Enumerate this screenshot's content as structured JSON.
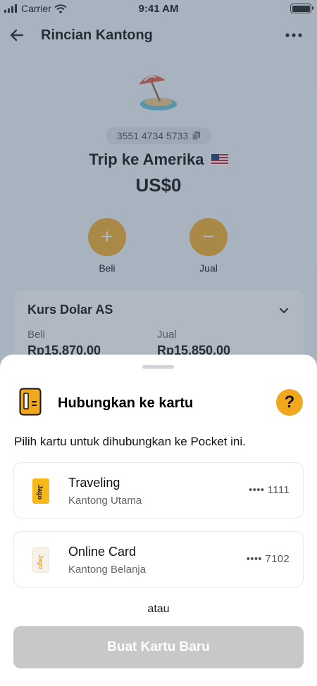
{
  "status_bar": {
    "carrier": "Carrier",
    "time": "9:41 AM"
  },
  "header": {
    "title": "Rincian Kantong",
    "back_icon": "arrow-left-icon",
    "more_icon": "more-horizontal-icon"
  },
  "pocket": {
    "icon": "beach-island-icon",
    "account_number": "3551 4734 5733",
    "name": "Trip ke Amerika",
    "flag": "us-flag-icon",
    "balance": "US$0"
  },
  "actions": {
    "buy_label": "Beli",
    "sell_label": "Jual"
  },
  "rate_card": {
    "title": "Kurs Dolar AS",
    "buy_label": "Beli",
    "buy_value": "Rp15.870,00",
    "sell_label": "Jual",
    "sell_value": "Rp15.850,00"
  },
  "sheet": {
    "title": "Hubungkan ke kartu",
    "help_label": "?",
    "description": "Pilih kartu untuk dihubungkan ke Pocket ini.",
    "cards": [
      {
        "name": "Traveling",
        "pocket": "Kantong Utama",
        "number": "•••• 1111",
        "brand": "Jago",
        "color": "#f9b81a"
      },
      {
        "name": "Online Card",
        "pocket": "Kantong Belanja",
        "number": "•••• 7102",
        "brand": "Jago",
        "color": "#f6f2ea"
      }
    ],
    "or_text": "atau",
    "create_button_label": "Buat Kartu Baru"
  },
  "colors": {
    "accent": "#f2a81d",
    "disabled_button": "#c8c8c8"
  }
}
